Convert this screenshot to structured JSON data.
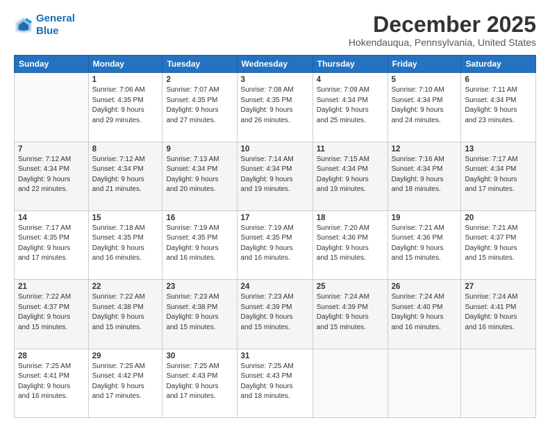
{
  "logo": {
    "line1": "General",
    "line2": "Blue"
  },
  "title": "December 2025",
  "location": "Hokendauqua, Pennsylvania, United States",
  "days_header": [
    "Sunday",
    "Monday",
    "Tuesday",
    "Wednesday",
    "Thursday",
    "Friday",
    "Saturday"
  ],
  "weeks": [
    [
      {
        "num": "",
        "info": ""
      },
      {
        "num": "1",
        "info": "Sunrise: 7:06 AM\nSunset: 4:35 PM\nDaylight: 9 hours\nand 29 minutes."
      },
      {
        "num": "2",
        "info": "Sunrise: 7:07 AM\nSunset: 4:35 PM\nDaylight: 9 hours\nand 27 minutes."
      },
      {
        "num": "3",
        "info": "Sunrise: 7:08 AM\nSunset: 4:35 PM\nDaylight: 9 hours\nand 26 minutes."
      },
      {
        "num": "4",
        "info": "Sunrise: 7:09 AM\nSunset: 4:34 PM\nDaylight: 9 hours\nand 25 minutes."
      },
      {
        "num": "5",
        "info": "Sunrise: 7:10 AM\nSunset: 4:34 PM\nDaylight: 9 hours\nand 24 minutes."
      },
      {
        "num": "6",
        "info": "Sunrise: 7:11 AM\nSunset: 4:34 PM\nDaylight: 9 hours\nand 23 minutes."
      }
    ],
    [
      {
        "num": "7",
        "info": "Sunrise: 7:12 AM\nSunset: 4:34 PM\nDaylight: 9 hours\nand 22 minutes."
      },
      {
        "num": "8",
        "info": "Sunrise: 7:12 AM\nSunset: 4:34 PM\nDaylight: 9 hours\nand 21 minutes."
      },
      {
        "num": "9",
        "info": "Sunrise: 7:13 AM\nSunset: 4:34 PM\nDaylight: 9 hours\nand 20 minutes."
      },
      {
        "num": "10",
        "info": "Sunrise: 7:14 AM\nSunset: 4:34 PM\nDaylight: 9 hours\nand 19 minutes."
      },
      {
        "num": "11",
        "info": "Sunrise: 7:15 AM\nSunset: 4:34 PM\nDaylight: 9 hours\nand 19 minutes."
      },
      {
        "num": "12",
        "info": "Sunrise: 7:16 AM\nSunset: 4:34 PM\nDaylight: 9 hours\nand 18 minutes."
      },
      {
        "num": "13",
        "info": "Sunrise: 7:17 AM\nSunset: 4:34 PM\nDaylight: 9 hours\nand 17 minutes."
      }
    ],
    [
      {
        "num": "14",
        "info": "Sunrise: 7:17 AM\nSunset: 4:35 PM\nDaylight: 9 hours\nand 17 minutes."
      },
      {
        "num": "15",
        "info": "Sunrise: 7:18 AM\nSunset: 4:35 PM\nDaylight: 9 hours\nand 16 minutes."
      },
      {
        "num": "16",
        "info": "Sunrise: 7:19 AM\nSunset: 4:35 PM\nDaylight: 9 hours\nand 16 minutes."
      },
      {
        "num": "17",
        "info": "Sunrise: 7:19 AM\nSunset: 4:35 PM\nDaylight: 9 hours\nand 16 minutes."
      },
      {
        "num": "18",
        "info": "Sunrise: 7:20 AM\nSunset: 4:36 PM\nDaylight: 9 hours\nand 15 minutes."
      },
      {
        "num": "19",
        "info": "Sunrise: 7:21 AM\nSunset: 4:36 PM\nDaylight: 9 hours\nand 15 minutes."
      },
      {
        "num": "20",
        "info": "Sunrise: 7:21 AM\nSunset: 4:37 PM\nDaylight: 9 hours\nand 15 minutes."
      }
    ],
    [
      {
        "num": "21",
        "info": "Sunrise: 7:22 AM\nSunset: 4:37 PM\nDaylight: 9 hours\nand 15 minutes."
      },
      {
        "num": "22",
        "info": "Sunrise: 7:22 AM\nSunset: 4:38 PM\nDaylight: 9 hours\nand 15 minutes."
      },
      {
        "num": "23",
        "info": "Sunrise: 7:23 AM\nSunset: 4:38 PM\nDaylight: 9 hours\nand 15 minutes."
      },
      {
        "num": "24",
        "info": "Sunrise: 7:23 AM\nSunset: 4:39 PM\nDaylight: 9 hours\nand 15 minutes."
      },
      {
        "num": "25",
        "info": "Sunrise: 7:24 AM\nSunset: 4:39 PM\nDaylight: 9 hours\nand 15 minutes."
      },
      {
        "num": "26",
        "info": "Sunrise: 7:24 AM\nSunset: 4:40 PM\nDaylight: 9 hours\nand 16 minutes."
      },
      {
        "num": "27",
        "info": "Sunrise: 7:24 AM\nSunset: 4:41 PM\nDaylight: 9 hours\nand 16 minutes."
      }
    ],
    [
      {
        "num": "28",
        "info": "Sunrise: 7:25 AM\nSunset: 4:41 PM\nDaylight: 9 hours\nand 16 minutes."
      },
      {
        "num": "29",
        "info": "Sunrise: 7:25 AM\nSunset: 4:42 PM\nDaylight: 9 hours\nand 17 minutes."
      },
      {
        "num": "30",
        "info": "Sunrise: 7:25 AM\nSunset: 4:43 PM\nDaylight: 9 hours\nand 17 minutes."
      },
      {
        "num": "31",
        "info": "Sunrise: 7:25 AM\nSunset: 4:43 PM\nDaylight: 9 hours\nand 18 minutes."
      },
      {
        "num": "",
        "info": ""
      },
      {
        "num": "",
        "info": ""
      },
      {
        "num": "",
        "info": ""
      }
    ]
  ]
}
